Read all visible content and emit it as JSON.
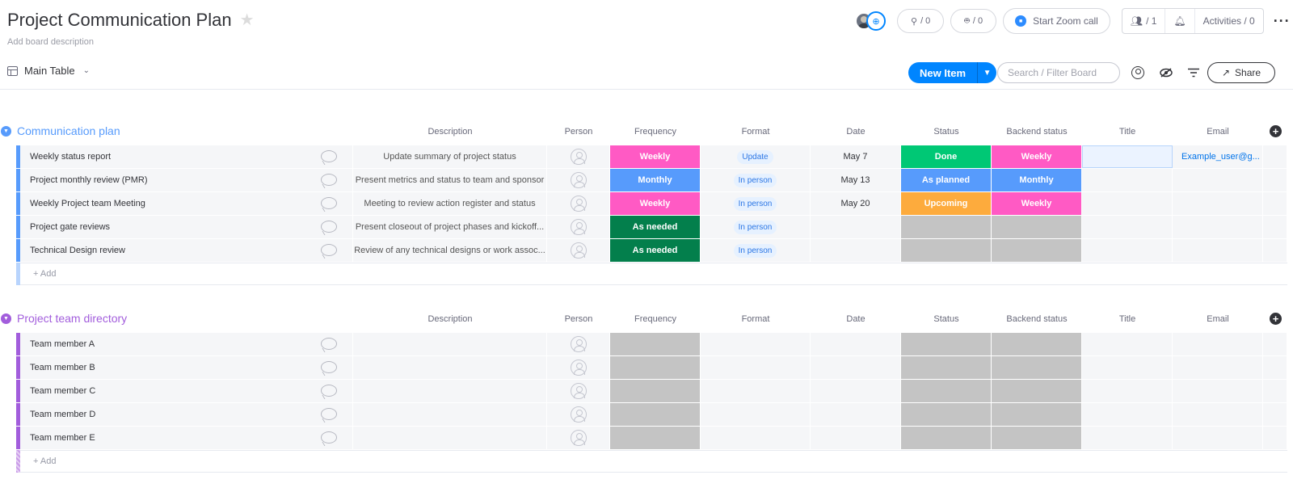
{
  "board": {
    "title": "Project Communication Plan",
    "description": "Add board description"
  },
  "header_actions": {
    "integrations_count": "/ 0",
    "automations_count": "/ 0",
    "zoom_label": "Start Zoom call",
    "members_count": "/ 1",
    "activities_label": "Activities / 0"
  },
  "toolbar": {
    "view_label": "Main Table",
    "new_item_label": "New Item",
    "search_placeholder": "Search / Filter Board",
    "share_label": "Share"
  },
  "columns": [
    "Description",
    "Person",
    "Frequency",
    "Format",
    "Date",
    "Status",
    "Backend status",
    "Title",
    "Email"
  ],
  "groups": [
    {
      "title": "Communication plan",
      "color": "#579bfc",
      "add_label": "+ Add",
      "rows": [
        {
          "name": "Weekly status report",
          "description": "Update summary of project status",
          "frequency": "Weekly",
          "format": "Update",
          "date": "May 7",
          "status": "Done",
          "backend": "Weekly",
          "email": "Example_user@g..."
        },
        {
          "name": "Project monthly review (PMR)",
          "description": "Present metrics and status to team and sponsor",
          "frequency": "Monthly",
          "format": "In person",
          "date": "May 13",
          "status": "As planned",
          "backend": "Monthly",
          "email": ""
        },
        {
          "name": "Weekly Project team Meeting",
          "description": "Meeting to review action register and status",
          "frequency": "Weekly",
          "format": "In person",
          "date": "May 20",
          "status": "Upcoming",
          "backend": "Weekly",
          "email": ""
        },
        {
          "name": "Project gate reviews",
          "description": "Present closeout of project phases and kickoff...",
          "frequency": "As needed",
          "format": "In person",
          "date": "",
          "status": "",
          "backend": "",
          "email": ""
        },
        {
          "name": "Technical Design review",
          "description": "Review of any technical designs or work assoc...",
          "frequency": "As needed",
          "format": "In person",
          "date": "",
          "status": "",
          "backend": "",
          "email": ""
        }
      ]
    },
    {
      "title": "Project team directory",
      "color": "#a25ddc",
      "add_label": "+ Add",
      "rows": [
        {
          "name": "Team member A"
        },
        {
          "name": "Team member B"
        },
        {
          "name": "Team member C"
        },
        {
          "name": "Team member D"
        },
        {
          "name": "Team member E"
        }
      ]
    }
  ],
  "status_colors": {
    "Weekly": "#ff5ac4",
    "Monthly": "#579bfc",
    "As needed": "#037f4c",
    "Done": "#00c875",
    "As planned": "#579bfc",
    "Upcoming": "#fdab3d",
    "empty": "#c4c4c4"
  }
}
